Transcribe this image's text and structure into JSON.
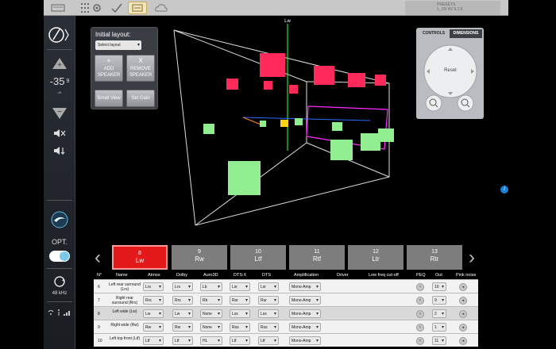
{
  "topbar": {
    "preset_title": "PRESETS",
    "preset_sub": "1_16/ 4V 9.1.6"
  },
  "leftbar": {
    "volume": "-35",
    "volume_decimal": "9",
    "volume_unit": "dB",
    "opt_label": "OPT.",
    "sample_rate": "48 kHz"
  },
  "layout_panel": {
    "title": "Initial layout:",
    "select_placeholder": "Select layout",
    "add_symbol": "+",
    "add_line1": "ADD",
    "add_line2": "SPEAKER",
    "remove_symbol": "X",
    "remove_line1": "REMOVE",
    "remove_line2": "SPEAKER",
    "small_view": "Small View",
    "set_gain": "Set Gain"
  },
  "viewport": {
    "axis_label": "Lw"
  },
  "controls": {
    "tab_controls": "CONTROLS",
    "tab_dimensions": "DIMENSIONS",
    "reset": "Reset"
  },
  "speakers": [
    {
      "num": "8",
      "name": "Lw"
    },
    {
      "num": "9",
      "name": "Rw"
    },
    {
      "num": "10",
      "name": "Ltf"
    },
    {
      "num": "11",
      "name": "Rtf"
    },
    {
      "num": "12",
      "name": "Ltr"
    },
    {
      "num": "13",
      "name": "Rtr"
    }
  ],
  "table": {
    "headers": [
      "N°",
      "Name",
      "Atmos",
      "Dolby",
      "Auro3D",
      "DTS:X",
      "DTS",
      "Amplification",
      "Driver",
      "Low freq cut-off",
      "PEQ",
      "Out",
      "Pink noise"
    ],
    "rows": [
      {
        "n": "6",
        "name": "Left rear surround (Lrs)",
        "atmos": "Lrs",
        "dolby": "Lrs",
        "auro": "Lb",
        "dtsx": "Lsr",
        "dts": "Lsr",
        "amp": "Mono-Amp",
        "out": "10"
      },
      {
        "n": "7",
        "name": "Right rear surround (Rrs)",
        "atmos": "Rrs",
        "dolby": "Rrs",
        "auro": "Rb",
        "dtsx": "Rsr",
        "dts": "Rsr",
        "amp": "Mono-Amp",
        "out": "9"
      },
      {
        "n": "8",
        "name": "Left wide (Lw)",
        "atmos": "Lw",
        "dolby": "Lw",
        "auro": "None",
        "dtsx": "Lss",
        "dts": "Lss",
        "amp": "Mono-Amp",
        "out": "2"
      },
      {
        "n": "9",
        "name": "Right wide (Rw)",
        "atmos": "Rw",
        "dolby": "Rw",
        "auro": "None",
        "dtsx": "Rss",
        "dts": "Rss",
        "amp": "Mono-Amp",
        "out": "1"
      },
      {
        "n": "10",
        "name": "Left top front (Ltf)",
        "atmos": "Ltf",
        "dolby": "Ltf",
        "auro": "HL",
        "dtsx": "Ltf",
        "dts": "Ltf",
        "amp": "Mono-Amp",
        "out": "11"
      }
    ]
  },
  "colors": {
    "selected_speaker": "#e41a1a",
    "active_cube": "#ff2a5a",
    "inactive_cube": "#90ee90",
    "axis_green": "#2adf2a",
    "axis_blue": "#2a6aff",
    "highlight_box": "#ff2aff"
  }
}
